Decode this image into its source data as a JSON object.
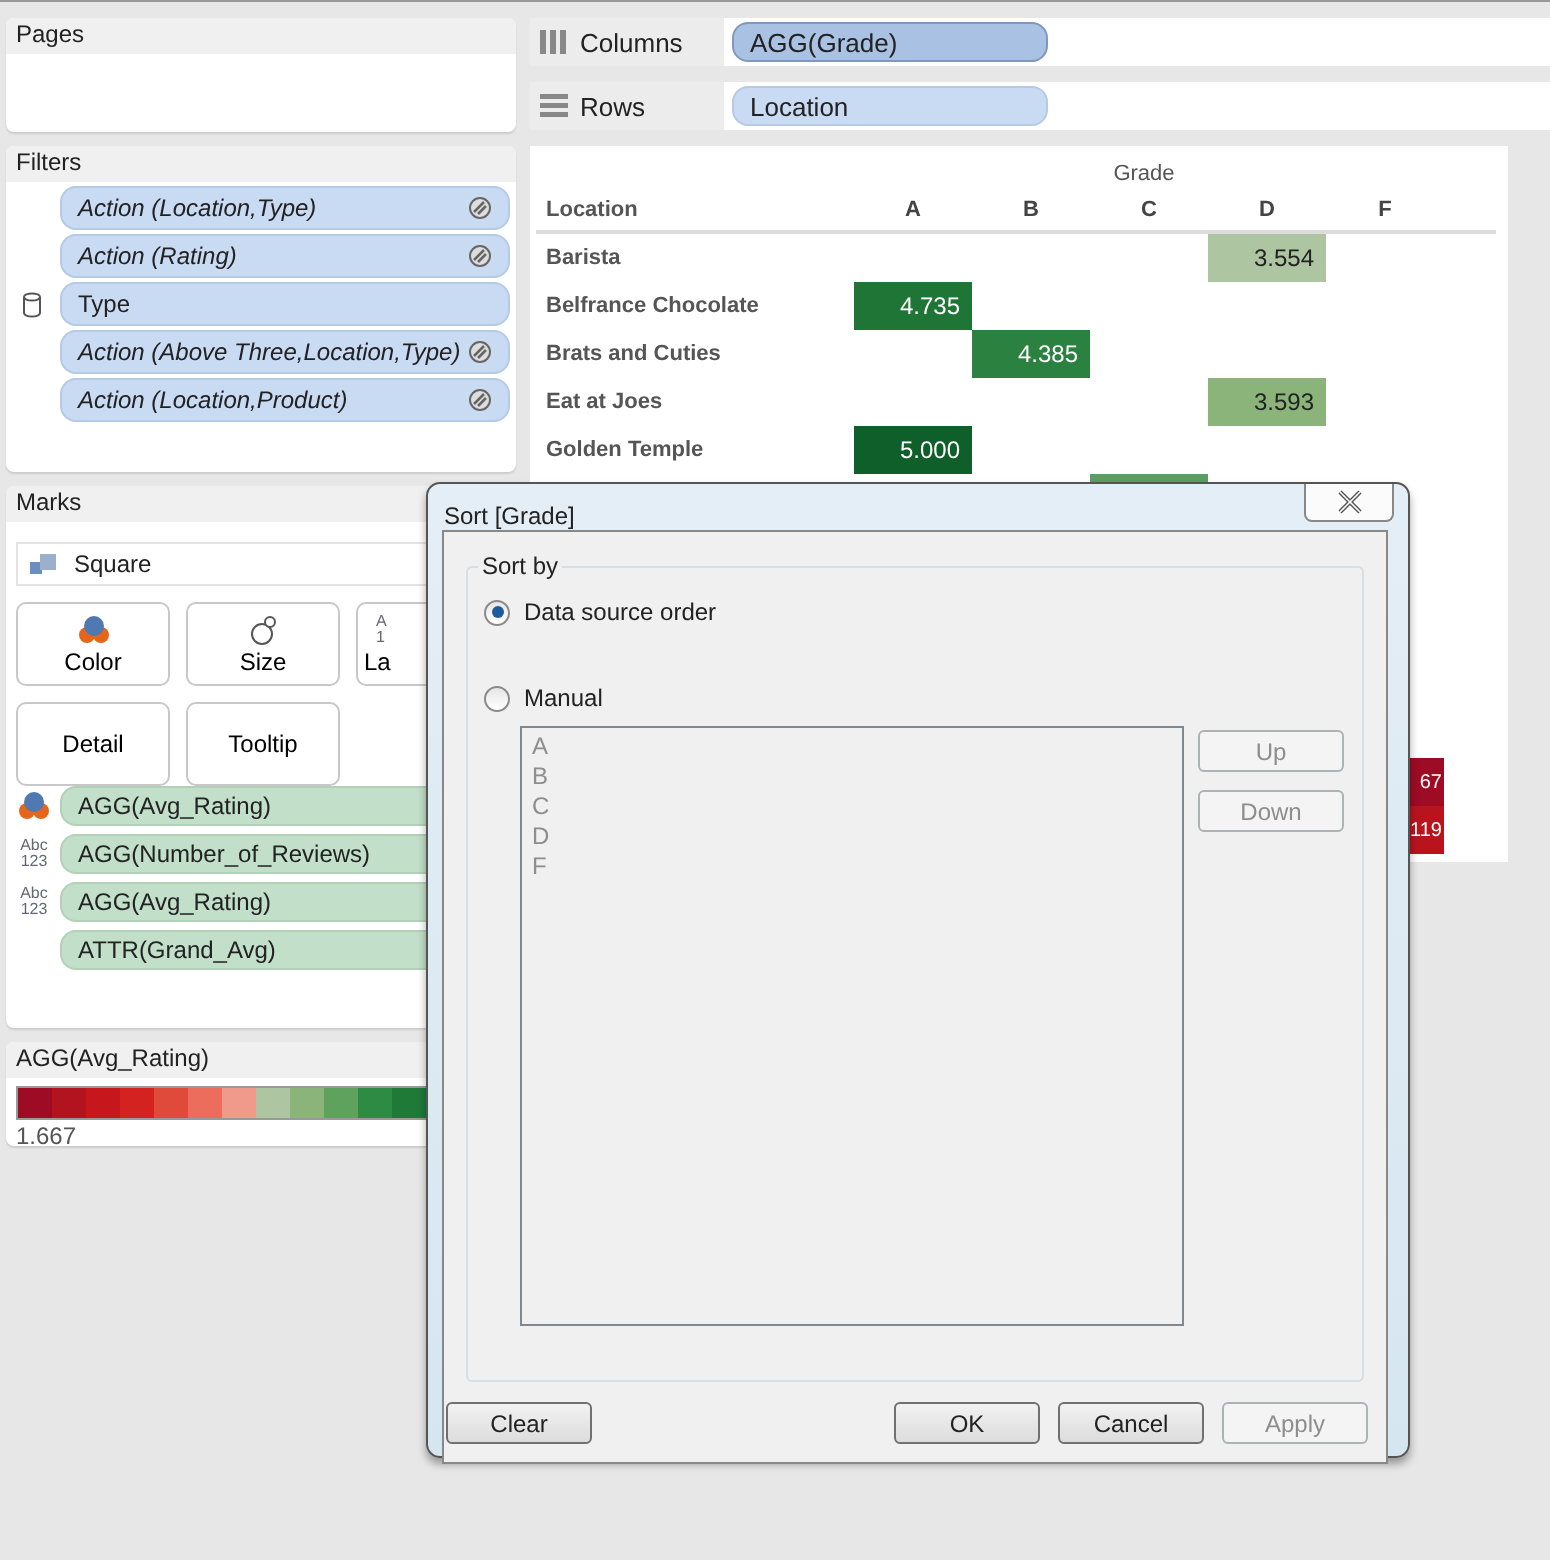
{
  "pages_panel": {
    "title": "Pages"
  },
  "filters_panel": {
    "title": "Filters",
    "items": [
      {
        "label": "Action (Location,Type)",
        "kind": "action"
      },
      {
        "label": "Action (Rating)",
        "kind": "action"
      },
      {
        "label": "Type",
        "kind": "dimension"
      },
      {
        "label": "Action (Above Three,Location,Type)",
        "kind": "action"
      },
      {
        "label": "Action (Location,Product)",
        "kind": "action"
      }
    ]
  },
  "marks_panel": {
    "title": "Marks",
    "mark_type": "Square",
    "cards": [
      {
        "label": "Color",
        "kind": "color"
      },
      {
        "label": "Size",
        "kind": "size"
      },
      {
        "label": "La",
        "kind": "label",
        "icon_lines": [
          "A",
          "1"
        ]
      },
      {
        "label": "Detail",
        "kind": "plain"
      },
      {
        "label": "Tooltip",
        "kind": "plain"
      }
    ],
    "fields": [
      {
        "label": "AGG(Avg_Rating)",
        "kind": "color"
      },
      {
        "label": "AGG(Number_of_Reviews)",
        "kind": "label",
        "icon_lines": [
          "Abc",
          "123"
        ]
      },
      {
        "label": "AGG(Avg_Rating)",
        "kind": "label",
        "icon_lines": [
          "Abc",
          "123"
        ]
      },
      {
        "label": "ATTR(Grand_Avg)",
        "kind": "detail"
      }
    ]
  },
  "legend": {
    "title": "AGG(Avg_Rating)",
    "min_label": "1.667",
    "swatches": [
      {
        "color": "#9e0b25"
      },
      {
        "color": "#b3121f"
      },
      {
        "color": "#c8171c"
      },
      {
        "color": "#d3221f"
      },
      {
        "color": "#e04a3a"
      },
      {
        "color": "#ec6d5b"
      },
      {
        "color": "#f09a8c"
      },
      {
        "color": "#adc5a0"
      },
      {
        "color": "#8ab47a"
      },
      {
        "color": "#5fa25e"
      },
      {
        "color": "#2e8b43"
      },
      {
        "color": "#1f7a38"
      }
    ]
  },
  "shelves": [
    {
      "kind": "columns",
      "label": "Columns",
      "pill": "AGG(Grade)"
    },
    {
      "kind": "rows",
      "label": "Rows",
      "pill": "Location"
    }
  ],
  "view": {
    "column_group": "Grade",
    "row_header": "Location",
    "columns": [
      "A",
      "B",
      "C",
      "D",
      "F"
    ],
    "rows": [
      {
        "location": "Barista",
        "cells": [
          "",
          "",
          "",
          {
            "value": "3.554",
            "color": "#adc5a0"
          },
          ""
        ]
      },
      {
        "location": "Belfrance Chocolate",
        "cells": [
          {
            "value": "4.735",
            "color": "#1e7536"
          },
          "",
          "",
          "",
          ""
        ]
      },
      {
        "location": "Brats and Cuties",
        "cells": [
          "",
          {
            "value": "4.385",
            "color": "#2a8140"
          },
          "",
          "",
          ""
        ]
      },
      {
        "location": "Eat at Joes",
        "cells": [
          "",
          "",
          "",
          {
            "value": "3.593",
            "color": "#8ab47a"
          },
          ""
        ]
      },
      {
        "location": "Golden Temple",
        "cells": [
          {
            "value": "5.000",
            "color": "#0e5f2a"
          },
          "",
          "",
          "",
          ""
        ]
      },
      {
        "cells": [
          "",
          "",
          {
            "color": "#5a9e64"
          },
          "",
          ""
        ]
      }
    ],
    "bottom_rows": [
      {
        "cells": [
          "",
          "",
          "",
          "",
          {
            "value": "67",
            "color": "#9e0b25"
          }
        ]
      },
      {
        "cells": [
          "",
          "",
          "",
          "",
          {
            "value": "119",
            "color": "#b9141e"
          }
        ]
      }
    ]
  },
  "dialog": {
    "title": "Sort [Grade]",
    "group": "Sort by",
    "options": [
      {
        "label": "Data source order",
        "selected": true
      },
      {
        "label": "Manual",
        "selected": false
      }
    ],
    "list": {
      "items": [
        "A",
        "B",
        "C",
        "D",
        "F"
      ],
      "disabled": true
    },
    "side_buttons": [
      {
        "label": "Up",
        "disabled": true
      },
      {
        "label": "Down",
        "disabled": true
      }
    ],
    "left_buttons": [
      {
        "label": "Clear",
        "disabled": false
      }
    ],
    "buttons": [
      {
        "label": "OK",
        "disabled": false
      },
      {
        "label": "Cancel",
        "disabled": false
      },
      {
        "label": "Apply",
        "disabled": true
      }
    ]
  }
}
